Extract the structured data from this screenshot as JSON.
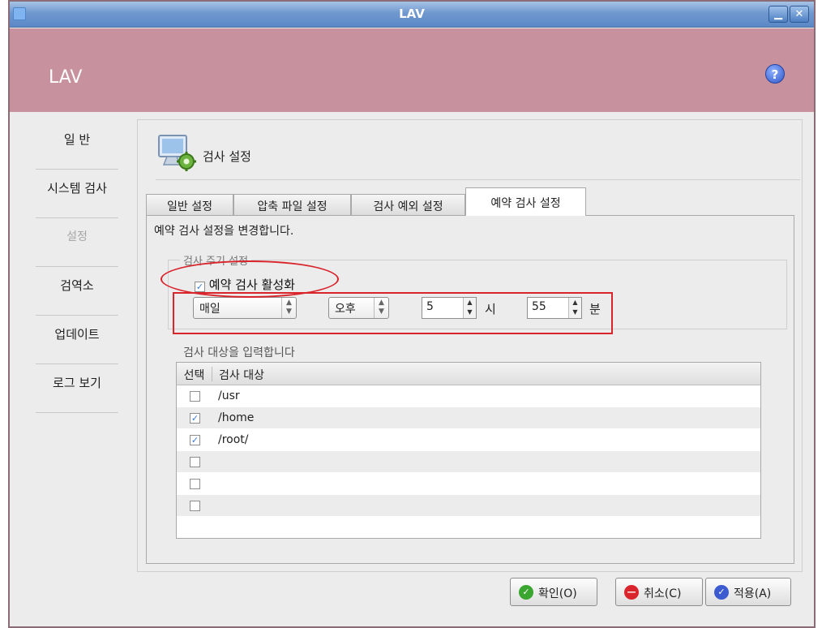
{
  "window": {
    "title": "LAV",
    "minimize_glyph": "▁",
    "close_glyph": "✕"
  },
  "header": {
    "app_name": "LAV",
    "help_glyph": "?"
  },
  "sidebar": {
    "items": [
      {
        "label": "일 반"
      },
      {
        "label": "시스템 검사"
      },
      {
        "label": "설정"
      },
      {
        "label": "검역소"
      },
      {
        "label": "업데이트"
      },
      {
        "label": "로그 보기"
      }
    ],
    "active_index": 2
  },
  "content": {
    "title": "검사 설정",
    "tabs": [
      {
        "label": "일반 설정"
      },
      {
        "label": "압축 파일 설정"
      },
      {
        "label": "검사 예외 설정"
      },
      {
        "label": "예약 검사 설정"
      }
    ],
    "active_tab_index": 3,
    "description": "예약 검사 설정을 변경합니다.",
    "schedule_group": {
      "title": "검사 주기 설정",
      "enable_label": "예약 검사 활성화",
      "enable_checked": true,
      "frequency_value": "매일",
      "ampm_value": "오후",
      "hour_value": "5",
      "hour_unit": "시",
      "minute_value": "55",
      "minute_unit": "분"
    },
    "targets": {
      "label": "검사 대상을 입력합니다",
      "header_select": "선택",
      "header_target": "검사 대상",
      "rows": [
        {
          "checked": false,
          "path": "/usr"
        },
        {
          "checked": true,
          "path": "/home"
        },
        {
          "checked": true,
          "path": "/root/"
        },
        {
          "checked": false,
          "path": ""
        },
        {
          "checked": false,
          "path": ""
        },
        {
          "checked": false,
          "path": ""
        }
      ]
    }
  },
  "buttons": {
    "ok": "확인(O)",
    "cancel": "취소(C)",
    "apply": "적용(A)"
  },
  "colors": {
    "header_bg": "#c7919d",
    "annotation": "#d9242b",
    "ok_icon": "#3aa52f",
    "cancel_icon": "#d9242b",
    "apply_icon": "#3c5bd1"
  },
  "icons": {
    "content_icon": "monitor-gear-icon",
    "checkbox_mark": "✓"
  }
}
